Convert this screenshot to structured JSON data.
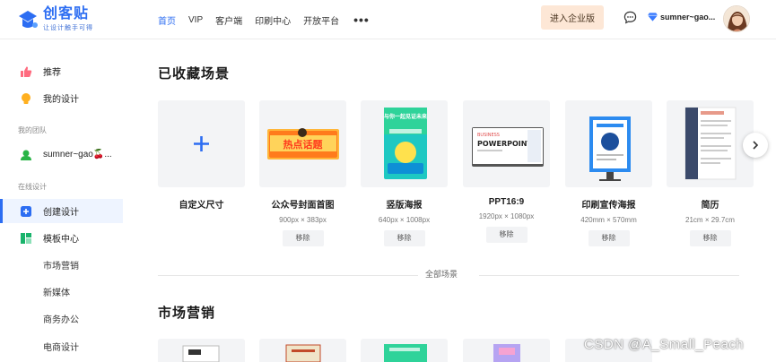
{
  "brand": {
    "name": "创客贴",
    "slogan": "让设计触手可得",
    "accent": "#2c6df2"
  },
  "nav": {
    "items": [
      {
        "label": "首页",
        "active": true
      },
      {
        "label": "VIP"
      },
      {
        "label": "客户端"
      },
      {
        "label": "印刷中心"
      },
      {
        "label": "开放平台"
      }
    ],
    "more": "•••"
  },
  "header": {
    "enterprise_label": "进入企业版",
    "message_icon": "chat-bubble-icon",
    "user_name": "sumner~gao..."
  },
  "sidebar": {
    "recommend": "推荐",
    "my_designs": "我的设计",
    "team_section": "我的团队",
    "team_name": "sumner~gao🍒...",
    "online_section": "在线设计",
    "create_design": "创建设计",
    "template_center": "模板中心",
    "sub_items": [
      "市场营销",
      "新媒体",
      "商务办公",
      "电商设计"
    ]
  },
  "main": {
    "collected_title": "已收藏场景",
    "cards": [
      {
        "name": "自定义尺寸",
        "size": "",
        "remove": ""
      },
      {
        "name": "公众号封面首图",
        "size": "900px × 383px",
        "remove": "移除",
        "art": "热点话题"
      },
      {
        "name": "竖版海报",
        "size": "640px × 1008px",
        "remove": "移除",
        "art": "与你一起见证未来"
      },
      {
        "name": "PPT16:9",
        "size": "1920px × 1080px",
        "remove": "移除",
        "art_top": "BUSINESS",
        "art": "POWERPOINT"
      },
      {
        "name": "印刷宣传海报",
        "size": "420mm × 570mm",
        "remove": "移除"
      },
      {
        "name": "简历",
        "size": "21cm × 29.7cm",
        "remove": "移除"
      }
    ],
    "all_scenes": "全部场景",
    "marketing_title": "市场营销"
  },
  "watermark": "CSDN @A_Small_Peach"
}
